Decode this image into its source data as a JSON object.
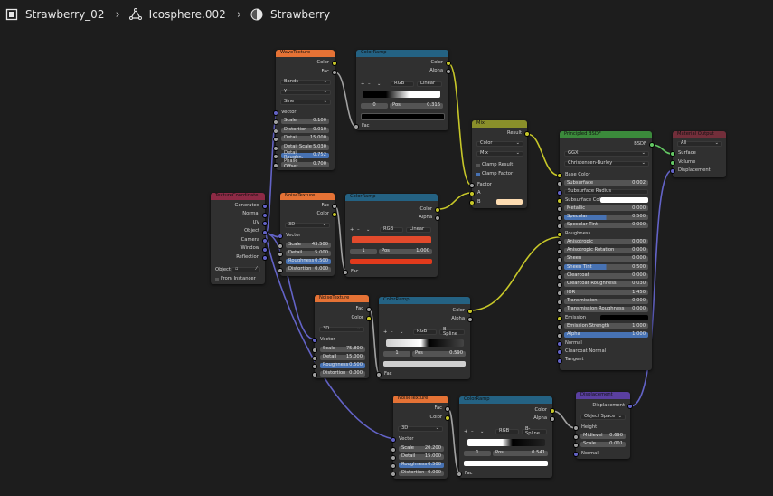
{
  "breadcrumb": {
    "object": "Strawberry_02",
    "mesh": "Icosphere.002",
    "material": "Strawberry"
  },
  "colors": {
    "background": "#1d1d1d",
    "texture": "#e57235",
    "converter": "#246283",
    "shader": "#3b8a3b",
    "output": "#722e3a",
    "wire_yellow": "#c7c729",
    "wire_purple": "#6363c7",
    "wire_gray": "#a1a1a1"
  },
  "nodes": {
    "wave": {
      "title": "WaveTexture",
      "out_color": "Color",
      "out_fac": "Fac",
      "type": "Bands",
      "dir": "Y",
      "profile": "Sine",
      "vector": "Vector",
      "fields": [
        {
          "l": "Scale",
          "v": "0.100"
        },
        {
          "l": "Distortion",
          "v": "0.010"
        },
        {
          "l": "Detail",
          "v": "15.000"
        },
        {
          "l": "Detail Scale",
          "v": "5.030"
        },
        {
          "l": "Detail Roughn.",
          "v": "0.752"
        },
        {
          "l": "Phase Offset",
          "v": "0.700"
        }
      ]
    },
    "ramp1": {
      "title": "ColorRamp",
      "out_color": "Color",
      "out_alpha": "Alpha",
      "mode": "RGB",
      "interp": "Linear",
      "index": "0",
      "pos_label": "Pos",
      "pos": "0.316",
      "in_fac": "Fac"
    },
    "coord": {
      "title": "TextureCoordinate",
      "outs": [
        "Generated",
        "Normal",
        "UV",
        "Object",
        "Camera",
        "Window",
        "Reflection"
      ],
      "object_label": "Object:",
      "from_instancer": "From Instancer"
    },
    "noise1": {
      "title": "NoiseTexture",
      "out_fac": "Fac",
      "out_color": "Color",
      "dim": "3D",
      "vector": "Vector",
      "fields": [
        {
          "l": "Scale",
          "v": "43.500"
        },
        {
          "l": "Detail",
          "v": "5.000"
        },
        {
          "l": "Roughness",
          "v": "0.500"
        },
        {
          "l": "Distortion",
          "v": "0.000"
        }
      ]
    },
    "ramp2": {
      "title": "ColorRamp",
      "out_color": "Color",
      "out_alpha": "Alpha",
      "mode": "RGB",
      "interp": "Linear",
      "index": "1",
      "pos_label": "Pos",
      "pos": "1.000",
      "in_fac": "Fac"
    },
    "mix": {
      "title": "Mix",
      "out_result": "Result",
      "data_type": "Color",
      "blend": "Mix",
      "clamp_result": "Clamp Result",
      "clamp_factor": "Clamp Factor",
      "in_factor": "Factor",
      "in_a": "A",
      "in_b": "B"
    },
    "bsdf": {
      "title": "Principled BSDF",
      "out_bsdf": "BSDF",
      "dist": "GGX",
      "sss_method": "Christensen-Burley",
      "rows": [
        {
          "l": "Base Color",
          "t": "sock"
        },
        {
          "l": "Subsurface",
          "v": "0.002"
        },
        {
          "l": "Subsurface Radius",
          "t": "dd"
        },
        {
          "l": "Subsurface Color",
          "t": "white"
        },
        {
          "l": "Metallic",
          "v": "0.000"
        },
        {
          "l": "Specular",
          "v": "0.500",
          "b": 1
        },
        {
          "l": "Specular Tint",
          "v": "0.000"
        },
        {
          "l": "Roughness",
          "t": "sock"
        },
        {
          "l": "Anisotropic",
          "v": "0.000"
        },
        {
          "l": "Anisotropic Rotation",
          "v": "0.000"
        },
        {
          "l": "Sheen",
          "v": "0.000"
        },
        {
          "l": "Sheen Tint",
          "v": "0.500",
          "b": 1
        },
        {
          "l": "Clearcoat",
          "v": "0.000"
        },
        {
          "l": "Clearcoat Roughness",
          "v": "0.030"
        },
        {
          "l": "IOR",
          "v": "1.450"
        },
        {
          "l": "Transmission",
          "v": "0.000"
        },
        {
          "l": "Transmission Roughness",
          "v": "0.000"
        },
        {
          "l": "Emission",
          "t": "black"
        },
        {
          "l": "Emission Strength",
          "v": "1.000"
        },
        {
          "l": "Alpha",
          "v": "1.000",
          "b": 2
        },
        {
          "l": "Normal",
          "t": "sock"
        },
        {
          "l": "Clearcoat Normal",
          "t": "sock"
        },
        {
          "l": "Tangent",
          "t": "sock"
        }
      ]
    },
    "output": {
      "title": "Material Output",
      "target": "All",
      "in_surface": "Surface",
      "in_volume": "Volume",
      "in_displacement": "Displacement"
    },
    "noise2": {
      "title": "NoiseTexture",
      "out_fac": "Fac",
      "out_color": "Color",
      "dim": "3D",
      "vector": "Vector",
      "fields": [
        {
          "l": "Scale",
          "v": "75.800"
        },
        {
          "l": "Detail",
          "v": "15.000"
        },
        {
          "l": "Roughness",
          "v": "0.500"
        },
        {
          "l": "Distortion",
          "v": "0.000"
        }
      ]
    },
    "ramp3": {
      "title": "ColorRamp",
      "out_color": "Color",
      "out_alpha": "Alpha",
      "mode": "RGB",
      "interp": "B-Spline",
      "index": "1",
      "pos_label": "Pos",
      "pos": "0.590",
      "in_fac": "Fac"
    },
    "noise3": {
      "title": "NoiseTexture",
      "out_fac": "Fac",
      "out_color": "Color",
      "dim": "3D",
      "vector": "Vector",
      "fields": [
        {
          "l": "Scale",
          "v": "20.200"
        },
        {
          "l": "Detail",
          "v": "15.000"
        },
        {
          "l": "Roughness",
          "v": "0.500"
        },
        {
          "l": "Distortion",
          "v": "0.000"
        }
      ]
    },
    "ramp4": {
      "title": "ColorRamp",
      "out_color": "Color",
      "out_alpha": "Alpha",
      "mode": "RGB",
      "interp": "B-Spline",
      "index": "1",
      "pos_label": "Pos",
      "pos": "0.541",
      "in_fac": "Fac"
    },
    "disp": {
      "title": "Displacement",
      "out_disp": "Displacement",
      "space": "Object Space",
      "height": "Height",
      "mid_label": "Midlevel",
      "mid": "0.690",
      "scale_label": "Scale",
      "scale": "0.001",
      "normal": "Normal"
    }
  }
}
